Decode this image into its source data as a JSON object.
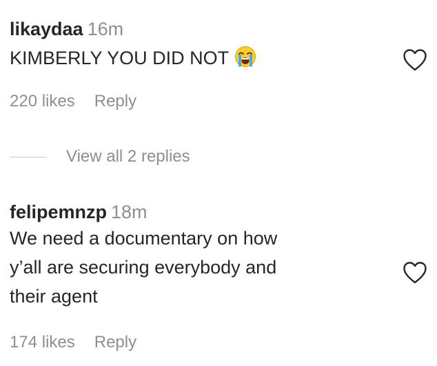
{
  "comments": [
    {
      "username": "likaydaa",
      "time": "16m",
      "text": "KIMBERLY YOU DID NOT",
      "emoji": "loudly-crying-face-icon",
      "likes": "220 likes",
      "reply_label": "Reply"
    },
    {
      "username": "felipemnzp",
      "time": "18m",
      "text_lines": [
        "We need a documentary on how",
        "y’all are securing everybody and",
        "their agent"
      ],
      "likes": "174 likes",
      "reply_label": "Reply"
    }
  ],
  "replies_toggle": {
    "label": "View all 2 replies"
  },
  "icons": {
    "like": "heart-outline-icon"
  },
  "colors": {
    "text": "#262626",
    "secondary": "#8e8e8e",
    "divider": "#c7c7c7"
  }
}
